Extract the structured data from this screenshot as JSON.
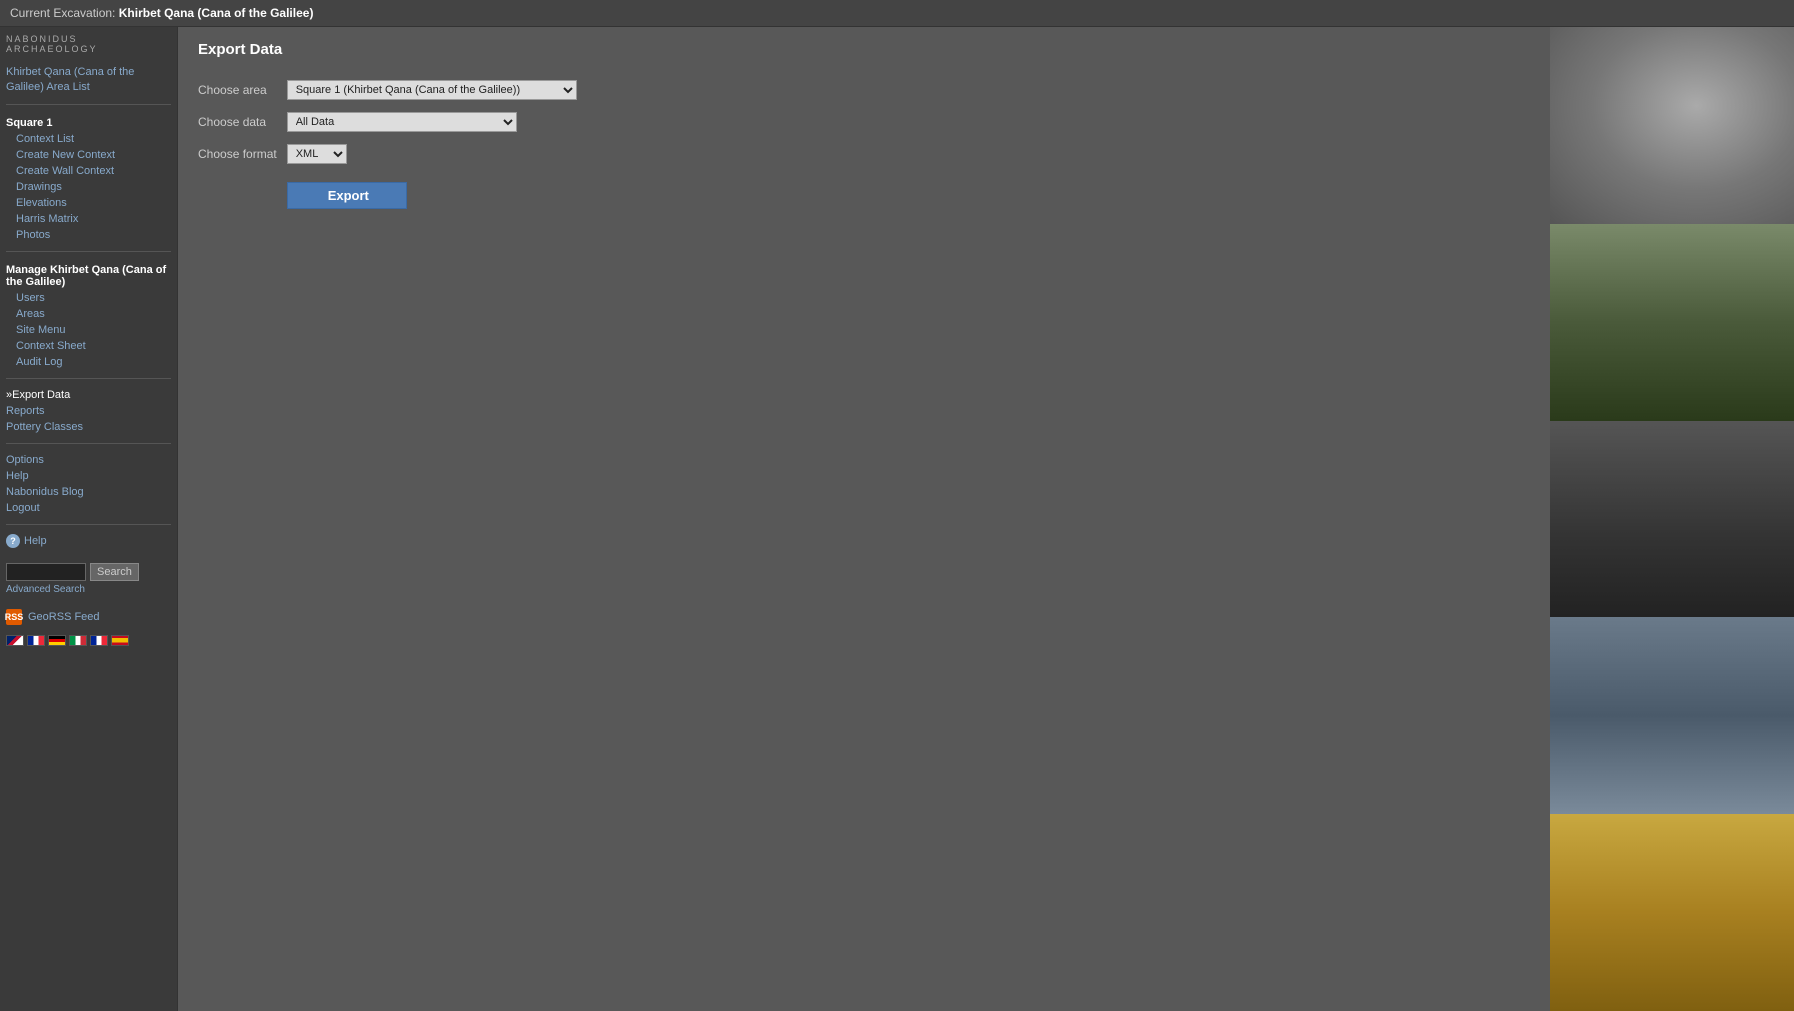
{
  "topbar": {
    "label": "Current Excavation:",
    "site_name": "Khirbet Qana (Cana of the Galilee)"
  },
  "sidebar": {
    "logo": "NABONIDUS",
    "logo_sub": "ARCHAEOLOGY",
    "site_link": "Khirbet Qana (Cana of the Galilee) Area List",
    "square_section": "Square 1",
    "square_items": [
      {
        "label": "Context List",
        "id": "context-list"
      },
      {
        "label": "Create New Context",
        "id": "create-new-context"
      },
      {
        "label": "Create Wall Context",
        "id": "create-wall-context"
      },
      {
        "label": "Drawings",
        "id": "drawings"
      },
      {
        "label": "Elevations",
        "id": "elevations"
      },
      {
        "label": "Harris Matrix",
        "id": "harris-matrix"
      },
      {
        "label": "Photos",
        "id": "photos"
      }
    ],
    "manage_section": "Manage Khirbet Qana (Cana of the Galilee)",
    "manage_items": [
      {
        "label": "Users",
        "id": "users"
      },
      {
        "label": "Areas",
        "id": "areas"
      },
      {
        "label": "Site Menu",
        "id": "site-menu"
      },
      {
        "label": "Context Sheet",
        "id": "context-sheet"
      },
      {
        "label": "Audit Log",
        "id": "audit-log"
      }
    ],
    "bottom_items": [
      {
        "label": "»Export Data",
        "id": "export-data",
        "active": true
      },
      {
        "label": "Reports",
        "id": "reports"
      },
      {
        "label": "Pottery Classes",
        "id": "pottery-classes"
      }
    ],
    "options_items": [
      {
        "label": "Options",
        "id": "options"
      },
      {
        "label": "Help",
        "id": "help"
      },
      {
        "label": "Nabonidus Blog",
        "id": "nabonidus-blog"
      },
      {
        "label": "Logout",
        "id": "logout"
      }
    ],
    "help_label": "Help",
    "search_placeholder": "",
    "search_button": "Search",
    "advanced_search": "Advanced Search",
    "georss_label": "GeoRSS Feed"
  },
  "main": {
    "title": "Export Data",
    "choose_area_label": "Choose area",
    "choose_area_value": "Square 1 (Khirbet Qana (Cana of the Galilee))",
    "choose_data_label": "Choose data",
    "choose_data_value": "All Data",
    "choose_format_label": "Choose format",
    "choose_format_value": "XML",
    "export_button": "Export"
  },
  "right_photos": [
    {
      "id": "photo-1",
      "alt": "excavation photo 1"
    },
    {
      "id": "photo-2",
      "alt": "excavation photo 2"
    },
    {
      "id": "photo-3",
      "alt": "excavation photo 3"
    },
    {
      "id": "photo-4",
      "alt": "excavation photo 4"
    },
    {
      "id": "photo-5",
      "alt": "excavation photo 5"
    }
  ]
}
